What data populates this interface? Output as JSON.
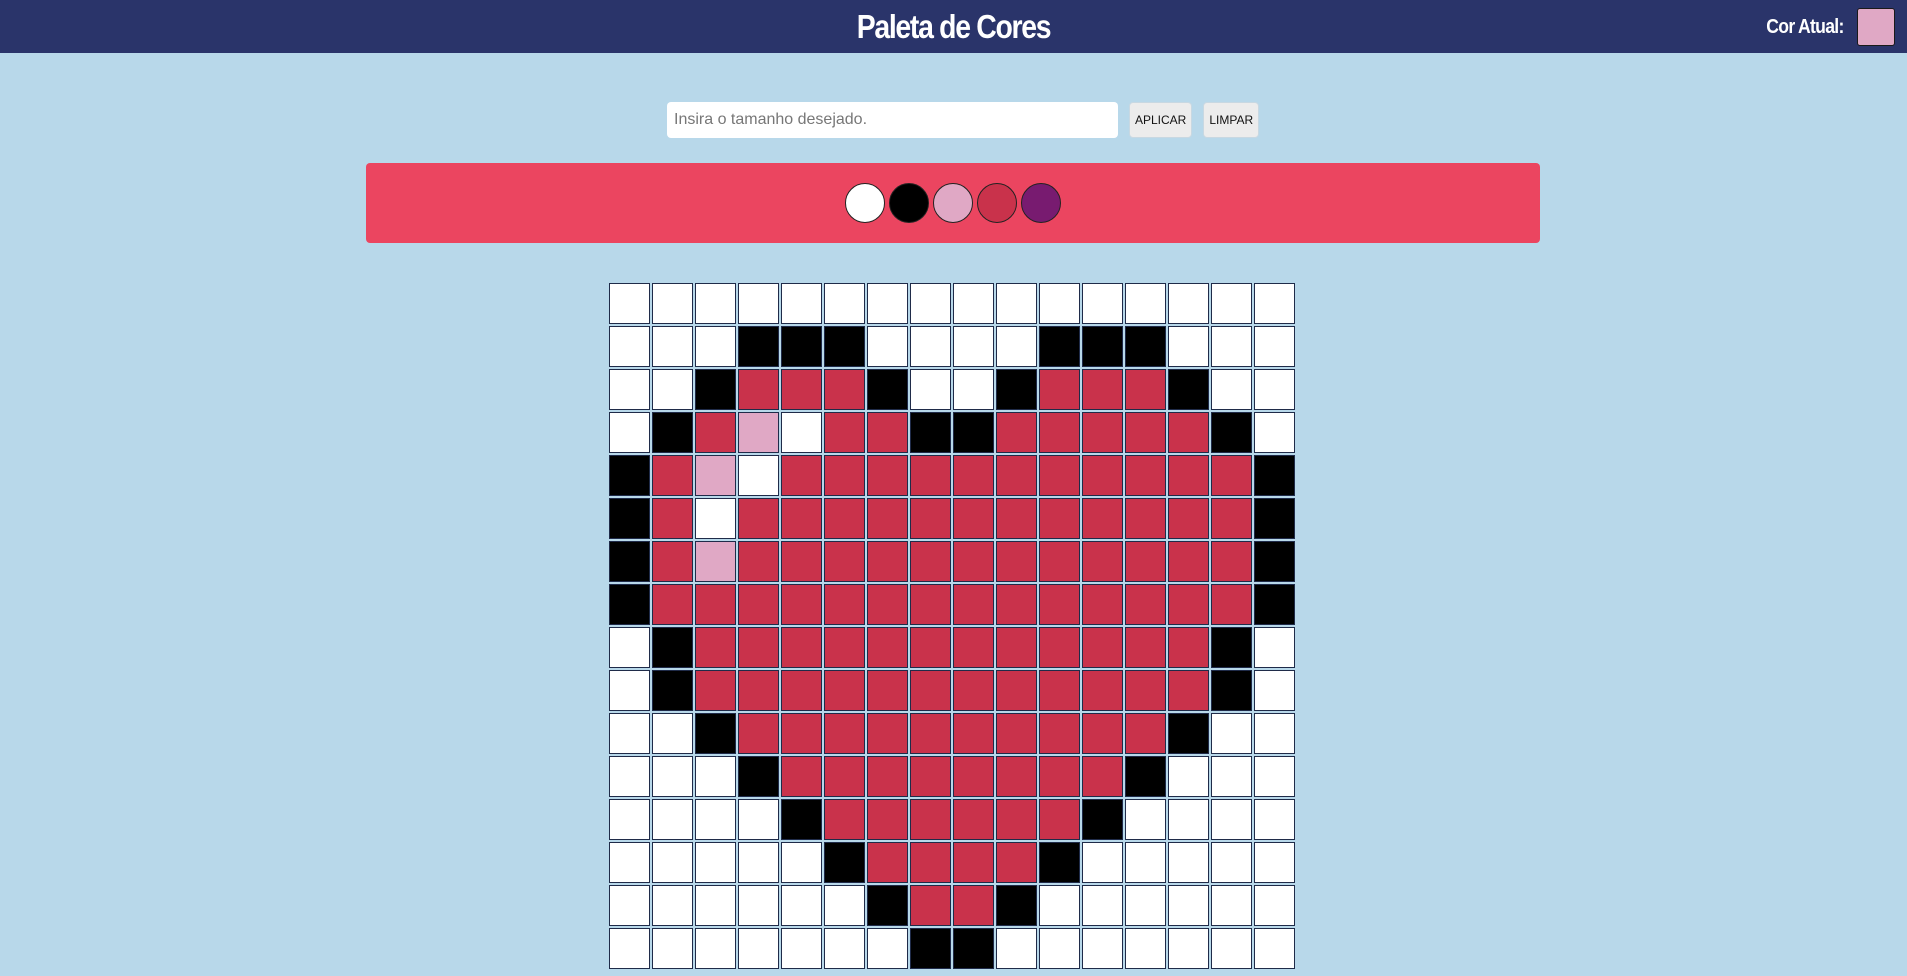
{
  "header": {
    "title": "Paleta de Cores",
    "current_label": "Cor Atual:",
    "current_color": "#e0a8c5"
  },
  "controls": {
    "input_placeholder": "Insira o tamanho desejado.",
    "input_value": "",
    "apply_label": "APLICAR",
    "clear_label": "LIMPAR"
  },
  "palette": [
    {
      "name": "white",
      "color": "#ffffff"
    },
    {
      "name": "black",
      "color": "#000000"
    },
    {
      "name": "pink",
      "color": "#e0a8c5"
    },
    {
      "name": "red",
      "color": "#c9324b"
    },
    {
      "name": "purple",
      "color": "#781b70"
    }
  ],
  "board": {
    "columns": 16,
    "colors": {
      "W": "#ffffff",
      "K": "#000000",
      "P": "#e0a8c5",
      "R": "#c9324b"
    },
    "rows": [
      "WWWWWWWWWWWWWWWW",
      "WWWKKKWWWWKKKWWW",
      "WWKRRRKWWKRRRKWW",
      "WKRPWRRKKRRRRRKW",
      "KRPWRRRRRRRRRRRK",
      "KRWRRRRRRRRRRRRK",
      "KRPRRRRRRRRRRRRK",
      "KRRRRRRRRRRRRRRK",
      "WKRRRRRRRRRRRRKW",
      "WKRRRRRRRRRRRRKW",
      "WWKRRRRRRRRRRKWW",
      "WWWKRRRRRRRRKWWW",
      "WWWWKRRRRRRKWWWW",
      "WWWWWKRRRRKWWWWW",
      "WWWWWWKRRKWWWWWW",
      "WWWWWWWKKWWWWWWW"
    ]
  }
}
